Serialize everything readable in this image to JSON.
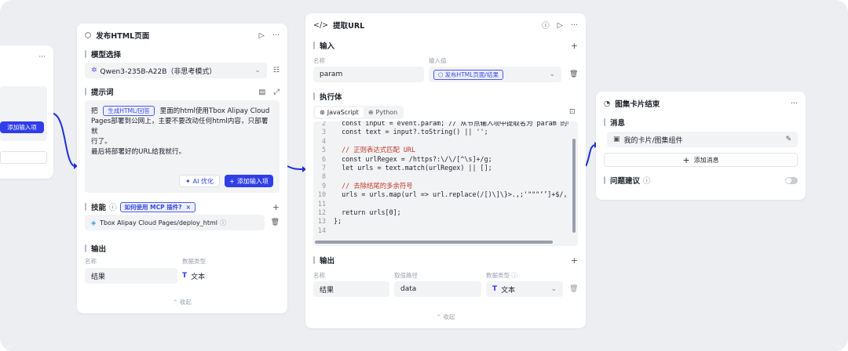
{
  "left_card": {
    "menu": "···",
    "add_input_label": "添加输入项"
  },
  "html_card": {
    "title": "发布HTML页面",
    "model_section": "模型选择",
    "model_value": "Qwen3-235B-A22B（非思考模式）",
    "prompt_section": "提示词",
    "prompt_pre": "把",
    "prompt_tag": "生成HTML/回答",
    "prompt_line1": "里面的html使用Tbox Alipay Cloud",
    "prompt_line2": "Pages部署到公网上，主要不要改动任何html内容，只部署就",
    "prompt_line3": "行了。",
    "prompt_line4": "最后将部署好的URL给我就行。",
    "ai_optimize": "AI 优化",
    "add_input": "添加输入项",
    "skills_section": "技能",
    "skills_tag": "如何使用 MCP 插件?",
    "skill_item": "Tbox Alipay Cloud Pages/deploy_html",
    "output_section": "输出",
    "col_name": "名称",
    "col_type": "数据类型",
    "out_name": "结果",
    "out_type": "文本",
    "collapse": "收起"
  },
  "url_card": {
    "title": "提取URL",
    "input_section": "输入",
    "col_name": "名称",
    "col_value": "输入值",
    "in_name": "param",
    "in_value_tag": "发布HTML页面/结果",
    "exec_section": "执行体",
    "tab_js": "JavaScript",
    "tab_py": "Python",
    "code_lines": [
      {
        "n": "2",
        "t": "  const input = event.param; // 从节点输入项中提取名为 param 的参"
      },
      {
        "n": "3",
        "t": "  const text = input?.toString() || '';"
      },
      {
        "n": "4",
        "t": ""
      },
      {
        "n": "5",
        "t": "  // 正则表达式匹配 URL"
      },
      {
        "n": "6",
        "t": "  const urlRegex = /https?:\\/\\/[^\\s]+/g;"
      },
      {
        "n": "7",
        "t": "  let urls = text.match(urlRegex) || [];"
      },
      {
        "n": "8",
        "t": ""
      },
      {
        "n": "9",
        "t": "  // 去除结尾的多余符号"
      },
      {
        "n": "10",
        "t": "  urls = urls.map(url => url.replace(/[)\\]\\}>.,;'\"\"\"‘’]+$/, '"
      },
      {
        "n": "11",
        "t": ""
      },
      {
        "n": "12",
        "t": "  return urls[0];"
      },
      {
        "n": "13",
        "t": "};"
      },
      {
        "n": "14",
        "t": ""
      }
    ],
    "output_section": "输出",
    "col_path": "取值路径",
    "col_type": "数据类型",
    "out_name": "结果",
    "out_path": "data",
    "out_type": "文本",
    "collapse": "收起"
  },
  "end_card": {
    "title": "图集卡片结束",
    "msg_section": "消息",
    "msg_item": "我的卡片/图集组件",
    "add_msg": "添加消息",
    "suggest": "问题建议"
  },
  "colors": {
    "accent": "#2f3ee8",
    "connector": "#1f2fd6"
  }
}
